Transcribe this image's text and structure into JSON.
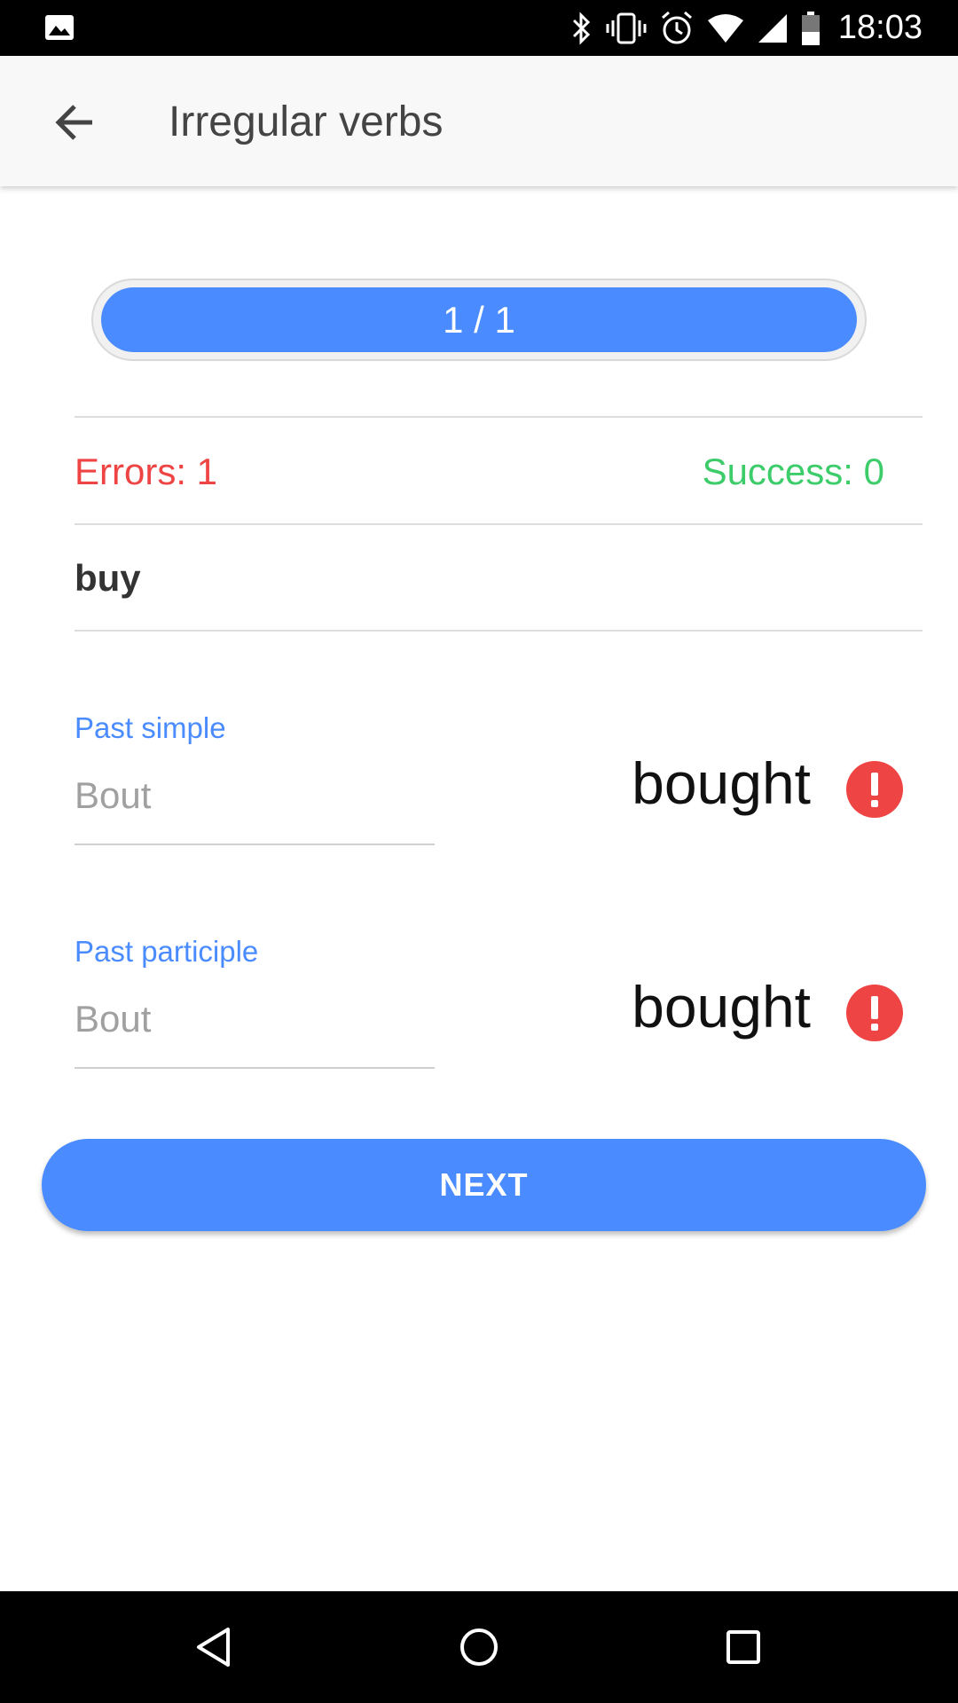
{
  "status_bar": {
    "time": "18:03",
    "icons": [
      "image-icon",
      "bluetooth-icon",
      "vibrate-icon",
      "alarm-icon",
      "wifi-icon",
      "cell-signal-icon",
      "battery-icon"
    ]
  },
  "app_bar": {
    "title": "Irregular verbs",
    "back_icon": "arrow-back-icon"
  },
  "progress": {
    "label": "1 / 1",
    "fraction": 1.0
  },
  "stats": {
    "errors": "Errors: 1",
    "success": "Success: 0"
  },
  "verb": {
    "base": "buy"
  },
  "fields": [
    {
      "label": "Past simple",
      "value": "Bout",
      "answer": "bought",
      "status_icon": "error-icon"
    },
    {
      "label": "Past participle",
      "value": "Bout",
      "answer": "bought",
      "status_icon": "error-icon"
    }
  ],
  "next_button": {
    "label": "NEXT"
  },
  "nav_bar": {
    "icons": [
      "nav-back-icon",
      "nav-home-icon",
      "nav-recents-icon"
    ]
  },
  "colors": {
    "accent": "#4a8cff",
    "error": "#ee4444",
    "success": "#3dcc6a"
  }
}
